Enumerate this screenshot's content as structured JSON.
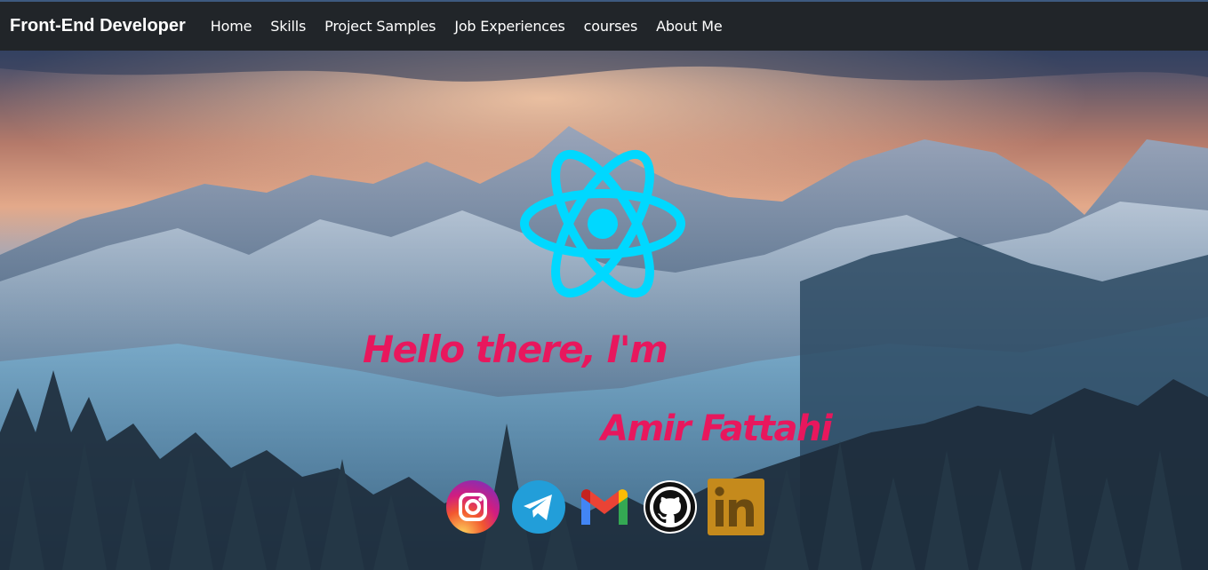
{
  "navbar": {
    "brand": "Front-End Developer",
    "links": [
      "Home",
      "Skills",
      "Project Samples",
      "Job Experiences",
      "courses",
      "About Me"
    ]
  },
  "hero": {
    "greeting": "Hello there, I'm",
    "name": "Amir Fattahi",
    "logo_icon": "react-atom-icon",
    "background_icon": "snowy-mountains-forest-image"
  },
  "socials": [
    {
      "icon": "instagram-icon"
    },
    {
      "icon": "telegram-icon"
    },
    {
      "icon": "gmail-icon"
    },
    {
      "icon": "github-icon"
    },
    {
      "icon": "linkedin-icon"
    }
  ],
  "colors": {
    "navbar_bg": "#212529",
    "accent_text": "#e8175d",
    "react_cyan": "#00d8ff",
    "linkedin_gold": "#c58a1c"
  }
}
